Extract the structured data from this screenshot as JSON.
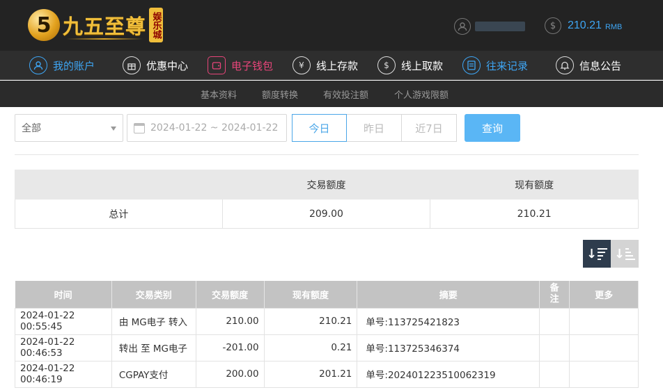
{
  "header": {
    "logo_badge": "5",
    "logo_text": "九五至尊",
    "logo_sub": "娱乐城",
    "balance": "210.21",
    "currency": "RMB"
  },
  "nav": {
    "items": [
      {
        "label": "我的账户",
        "icon": "user-icon"
      },
      {
        "label": "优惠中心",
        "icon": "gift-icon"
      },
      {
        "label": "电子钱包",
        "icon": "wallet-icon"
      },
      {
        "label": "线上存款",
        "icon": "deposit-icon"
      },
      {
        "label": "线上取款",
        "icon": "withdraw-icon"
      },
      {
        "label": "往来记录",
        "icon": "record-icon"
      },
      {
        "label": "信息公告",
        "icon": "bell-icon"
      }
    ]
  },
  "subnav": {
    "items": [
      "基本资料",
      "额度转换",
      "有效投注额",
      "个人游戏限额"
    ]
  },
  "filter": {
    "type_selected": "全部",
    "date_range": "2024-01-22 ~ 2024-01-22",
    "quick": [
      "今日",
      "昨日",
      "近7日"
    ],
    "query_label": "查询"
  },
  "summary": {
    "headers": [
      "",
      "交易额度",
      "现有额度"
    ],
    "row": [
      "总计",
      "209.00",
      "210.21"
    ]
  },
  "records": {
    "headers": [
      "时间",
      "交易类别",
      "交易额度",
      "现有额度",
      "摘要",
      "备注",
      "更多"
    ],
    "rows": [
      [
        "2024-01-22 00:55:45",
        "由 MG电子 转入",
        "210.00",
        "210.21",
        "单号:113725421823",
        "",
        ""
      ],
      [
        "2024-01-22 00:46:53",
        "转出 至 MG电子",
        "-201.00",
        "0.21",
        "单号:113725346374",
        "",
        ""
      ],
      [
        "2024-01-22 00:46:19",
        "CGPAY支付",
        "200.00",
        "201.21",
        "单号:202401223510062319",
        "",
        ""
      ]
    ]
  }
}
